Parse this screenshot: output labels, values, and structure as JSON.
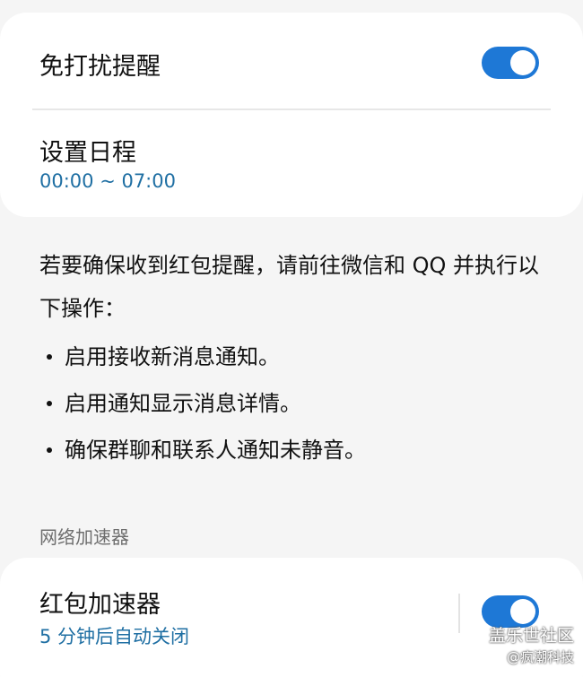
{
  "dnd": {
    "title": "免打扰提醒",
    "enabled": true
  },
  "schedule": {
    "title": "设置日程",
    "time_range": "00:00 ~ 07:00"
  },
  "info": {
    "intro": "若要确保收到红包提醒，请前往微信和 QQ 并执行以下操作：",
    "bullets": [
      "启用接收新消息通知。",
      "启用通知显示消息详情。",
      "确保群聊和联系人通知未静音。"
    ]
  },
  "network_section": {
    "header": "网络加速器"
  },
  "red_packet_accelerator": {
    "title": "红包加速器",
    "subtitle": "5 分钟后自动关闭",
    "enabled": true
  },
  "watermark": {
    "main": "盖乐世社区",
    "sub": "@疯潮科技"
  },
  "colors": {
    "accent": "#1e78d6",
    "subtitle": "#1f6fa3",
    "background": "#f5f5f5",
    "card": "#ffffff"
  }
}
